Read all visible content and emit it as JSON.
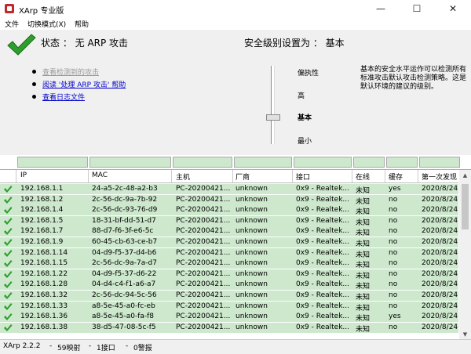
{
  "window": {
    "title": "XArp 专业版",
    "minimize": "—",
    "maximize": "☐",
    "close": "✕"
  },
  "menu": [
    "文件",
    "切换模式(X)",
    "帮助"
  ],
  "panel": {
    "status": "状态 ：  无 ARP 攻击",
    "security": "安全级别设置为 ：  基本",
    "links": [
      {
        "label": "查看检测到的攻击",
        "enabled": false
      },
      {
        "label": "阅读 '处理 ARP 攻击' 帮助",
        "enabled": true
      },
      {
        "label": "查看日志文件",
        "enabled": true
      }
    ],
    "levels": [
      "偏执性",
      "高",
      "基本",
      "最小"
    ],
    "description": "基本的安全水平运作可以检测所有标准攻击默认攻击检测策略。这是默认环境的建议的级别。"
  },
  "table": {
    "headers": [
      "IP",
      "MAC",
      "主机",
      "厂商",
      "接口",
      "在线",
      "缓存",
      "第一次发现"
    ],
    "rows": [
      [
        "192.168.1.1",
        "24-a5-2c-48-a2-b3",
        "PC-20200421...",
        "unknown",
        "0x9 - Realtek...",
        "未知",
        "yes",
        "2020/8/24"
      ],
      [
        "192.168.1.2",
        "2c-56-dc-9a-7b-92",
        "PC-20200421...",
        "unknown",
        "0x9 - Realtek...",
        "未知",
        "no",
        "2020/8/24"
      ],
      [
        "192.168.1.4",
        "2c-56-dc-93-76-d9",
        "PC-20200421...",
        "unknown",
        "0x9 - Realtek...",
        "未知",
        "no",
        "2020/8/24"
      ],
      [
        "192.168.1.5",
        "18-31-bf-dd-51-d7",
        "PC-20200421...",
        "unknown",
        "0x9 - Realtek...",
        "未知",
        "no",
        "2020/8/24"
      ],
      [
        "192.168.1.7",
        "88-d7-f6-3f-e6-5c",
        "PC-20200421...",
        "unknown",
        "0x9 - Realtek...",
        "未知",
        "no",
        "2020/8/24"
      ],
      [
        "192.168.1.9",
        "60-45-cb-63-ce-b7",
        "PC-20200421...",
        "unknown",
        "0x9 - Realtek...",
        "未知",
        "no",
        "2020/8/24"
      ],
      [
        "192.168.1.14",
        "04-d9-f5-37-d4-b6",
        "PC-20200421...",
        "unknown",
        "0x9 - Realtek...",
        "未知",
        "no",
        "2020/8/24"
      ],
      [
        "192.168.1.15",
        "2c-56-dc-9a-7a-d7",
        "PC-20200421...",
        "unknown",
        "0x9 - Realtek...",
        "未知",
        "no",
        "2020/8/24"
      ],
      [
        "192.168.1.22",
        "04-d9-f5-37-d6-22",
        "PC-20200421...",
        "unknown",
        "0x9 - Realtek...",
        "未知",
        "no",
        "2020/8/24"
      ],
      [
        "192.168.1.28",
        "04-d4-c4-f1-a6-a7",
        "PC-20200421...",
        "unknown",
        "0x9 - Realtek...",
        "未知",
        "no",
        "2020/8/24"
      ],
      [
        "192.168.1.32",
        "2c-56-dc-94-5c-56",
        "PC-20200421...",
        "unknown",
        "0x9 - Realtek...",
        "未知",
        "no",
        "2020/8/24"
      ],
      [
        "192.168.1.33",
        "a8-5e-45-a0-fc-eb",
        "PC-20200421...",
        "unknown",
        "0x9 - Realtek...",
        "未知",
        "no",
        "2020/8/24"
      ],
      [
        "192.168.1.36",
        "a8-5e-45-a0-fa-f8",
        "PC-20200421...",
        "unknown",
        "0x9 - Realtek...",
        "未知",
        "yes",
        "2020/8/24"
      ],
      [
        "192.168.1.38",
        "38-d5-47-08-5c-f5",
        "PC-20200421...",
        "unknown",
        "0x9 - Realtek...",
        "未知",
        "no",
        "2020/8/24"
      ]
    ]
  },
  "statusbar": {
    "version": "XArp 2.2.2",
    "mappings": "59映射",
    "interfaces": "1接口",
    "alerts": "0警报",
    "sep": "-"
  },
  "colors": {
    "row_bg": "#cde8cd",
    "check_green": "#2e9e2e",
    "link": "#0000cc"
  }
}
